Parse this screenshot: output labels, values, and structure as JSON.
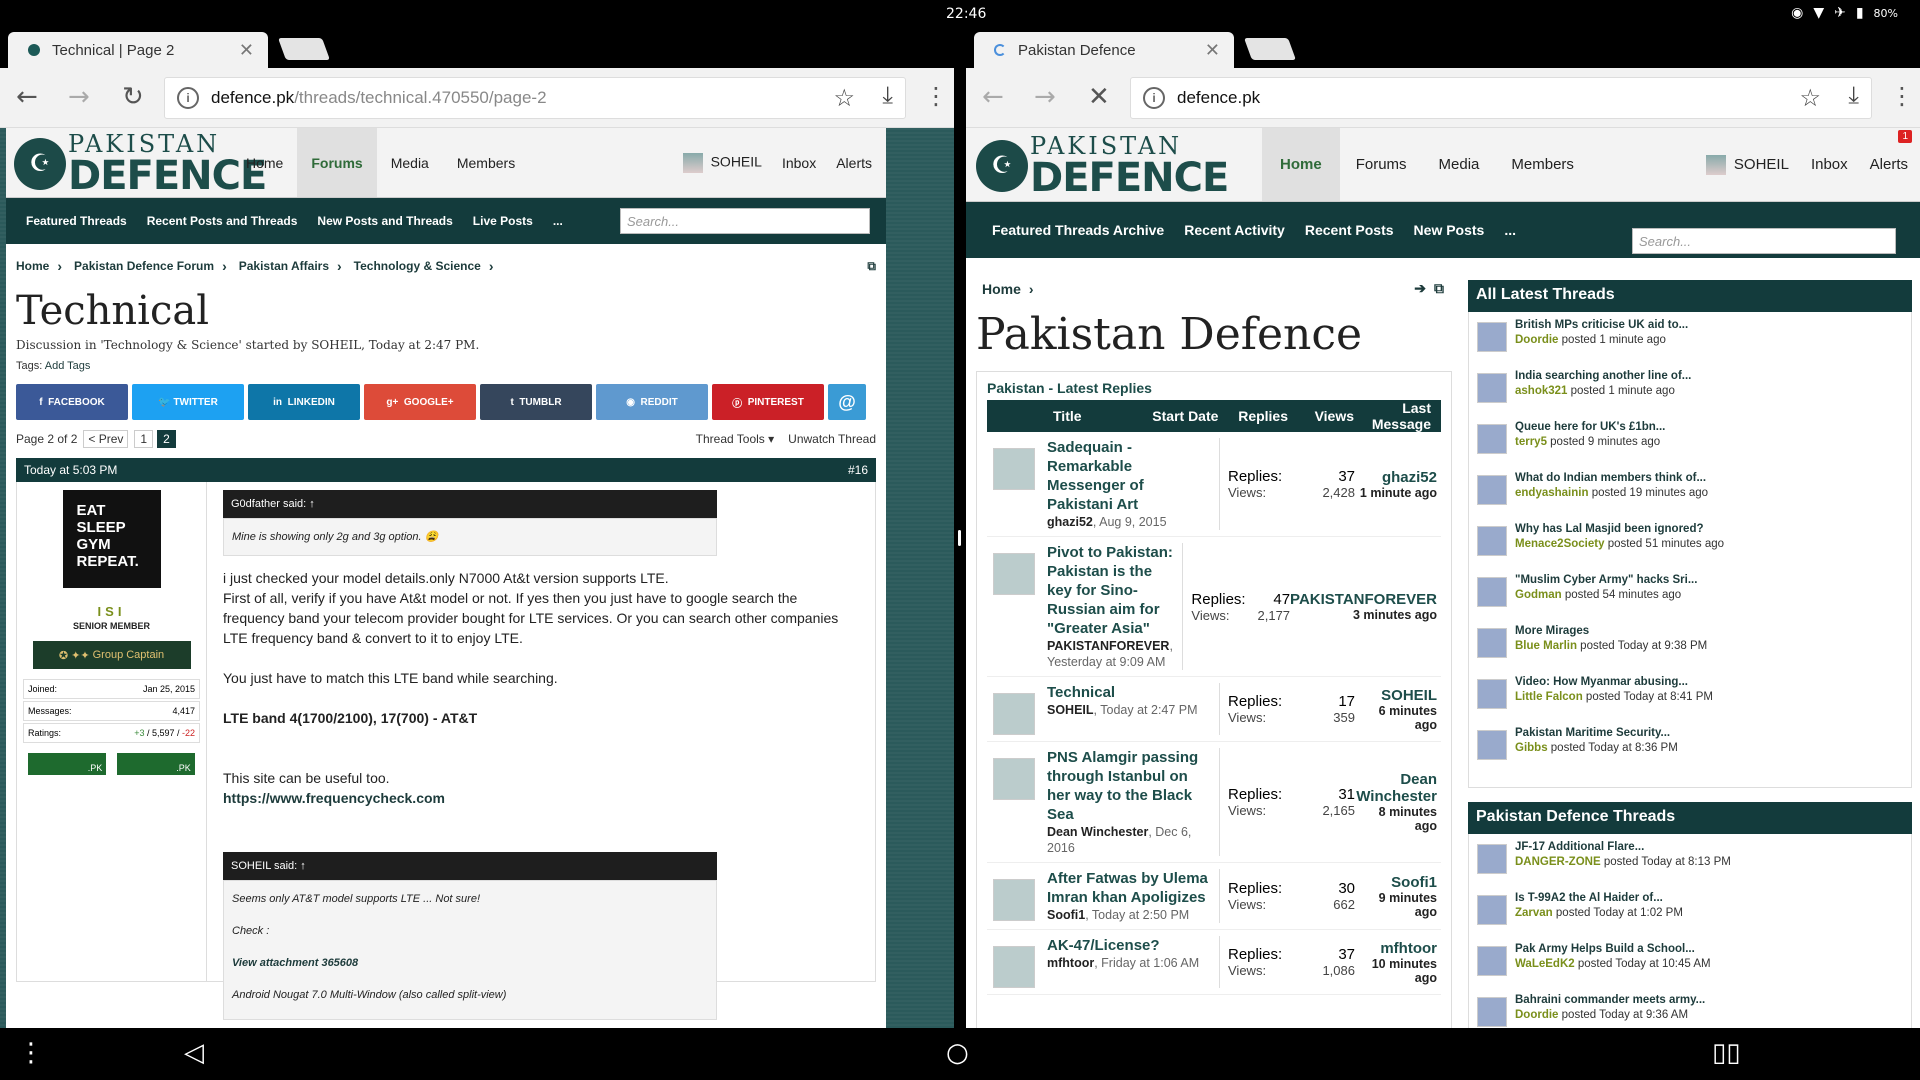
{
  "status": {
    "time": "22:46",
    "battery": "80%"
  },
  "left": {
    "tab_title": "Technical | Page 2",
    "url_host": "defence.pk",
    "url_path": "/threads/technical.470550/page-2",
    "logo_top": "PAKISTAN",
    "logo_bottom": "DEFENCE",
    "nav": [
      "Home",
      "Forums",
      "Media",
      "Members"
    ],
    "user": "SOHEIL",
    "inbox": "Inbox",
    "alerts": "Alerts",
    "subnav": [
      "Featured Threads",
      "Recent Posts and Threads",
      "New Posts and Threads",
      "Live Posts",
      "..."
    ],
    "search_placeholder": "Search...",
    "breadcrumb": [
      "Home",
      "Pakistan Defence Forum",
      "Pakistan Affairs",
      "Technology & Science"
    ],
    "title": "Technical",
    "discussion": "Discussion in 'Technology & Science' started by SOHEIL, Today at 2:47 PM.",
    "tags_label": "Tags:",
    "tags_add": "Add Tags",
    "social": [
      "FACEBOOK",
      "TWITTER",
      "LINKEDIN",
      "GOOGLE+",
      "TUMBLR",
      "REDDIT",
      "PINTEREST",
      "@"
    ],
    "page_of": "Page 2 of 2",
    "prev": "< Prev",
    "page1": "1",
    "page2": "2",
    "thread_tools": "Thread Tools ▾",
    "unwatch": "Unwatch Thread",
    "post_time": "Today at 5:03 PM",
    "post_num": "#16",
    "avatar_text": "EAT SLEEP GYM REPEAT.",
    "username": "ISI",
    "user_title": "SENIOR MEMBER",
    "rank": "Group Captain",
    "joined_l": "Joined:",
    "joined_v": "Jan 25, 2015",
    "messages_l": "Messages:",
    "messages_v": "4,417",
    "ratings_l": "Ratings:",
    "ratings_pos": "+3",
    "ratings_mid": " / 5,597 / ",
    "ratings_neg": "-22",
    "flag": ".PK",
    "quote1_head": "G0dfather said: ↑",
    "quote1_body": "Mine is showing only 2g and 3g option.",
    "p1": "i just checked your model details.only N7000 At&t version supports LTE.",
    "p2": "First of all, verify if you have At&t model or not. If yes then you just have to google search the frequency band your telecom provider bought for LTE services. Or you can search other companies LTE frequency band & convert to it to enjoy LTE.",
    "p3": "You just have to match this LTE band while searching.",
    "p4": "LTE band 4(1700/2100), 17(700) - AT&T",
    "p5": "This site can be useful too.",
    "p6": "https://www.frequencycheck.com",
    "quote2_head": "SOHEIL said: ↑",
    "quote2_l1": "Seems only AT&T model supports LTE ... Not sure!",
    "quote2_l2": "Check :",
    "quote2_l3": "View attachment 365608",
    "quote2_l4": "Android Nougat 7.0 Multi-Window (also called split-view)"
  },
  "right": {
    "tab_title": "Pakistan Defence",
    "url_host": "defence.pk",
    "nav": [
      "Home",
      "Forums",
      "Media",
      "Members"
    ],
    "user": "SOHEIL",
    "inbox": "Inbox",
    "alerts": "Alerts",
    "alert_count": "1",
    "subnav": [
      "Featured Threads Archive",
      "Recent Activity",
      "Recent Posts",
      "New Posts",
      "..."
    ],
    "search_placeholder": "Search...",
    "breadcrumb": "Home",
    "title": "Pakistan Defence",
    "latest_label": "Pakistan - Latest Replies",
    "cols": [
      "Title",
      "Start Date",
      "Replies",
      "Views",
      "Last Message"
    ],
    "threads": [
      {
        "title": "Sadequain - Remarkable Messenger of Pakistani Art",
        "by": "ghazi52",
        "date": ", Aug 9, 2015",
        "replies": "37",
        "views": "2,428",
        "last": "ghazi52",
        "ago": "1 minute ago"
      },
      {
        "title": "Pivot to Pakistan: Pakistan is the key for Sino-Russian aim for \"Greater Asia\"",
        "by": "PAKISTANFOREVER",
        "date": ", Yesterday at 9:09 AM",
        "replies": "47",
        "views": "2,177",
        "last": "PAKISTANFOREVER",
        "ago": "3 minutes ago"
      },
      {
        "title": "Technical",
        "by": "SOHEIL",
        "date": ", Today at 2:47 PM",
        "replies": "17",
        "views": "359",
        "last": "SOHEIL",
        "ago": "6 minutes ago"
      },
      {
        "title": "PNS Alamgir passing through Istanbul on her way to the Black Sea",
        "by": "Dean Winchester",
        "date": ", Dec 6, 2016",
        "replies": "31",
        "views": "2,165",
        "last": "Dean Winchester",
        "ago": "8 minutes ago"
      },
      {
        "title": "After Fatwas by Ulema Imran khan Apoligizes",
        "by": "Soofi1",
        "date": ", Today at 2:50 PM",
        "replies": "30",
        "views": "662",
        "last": "Soofi1",
        "ago": "9 minutes ago"
      },
      {
        "title": "AK-47/License?",
        "by": "mfhtoor",
        "date": ", Friday at 1:06 AM",
        "replies": "37",
        "views": "1,086",
        "last": "mfhtoor",
        "ago": "10 minutes ago"
      }
    ],
    "replies_l": "Replies:",
    "views_l": "Views:",
    "side1_title": "All Latest Threads",
    "side1": [
      {
        "t": "British MPs criticise UK aid to...",
        "u": "Doordie",
        "p": " posted 1 minute ago"
      },
      {
        "t": "India searching another line of...",
        "u": "ashok321",
        "p": " posted 1 minute ago"
      },
      {
        "t": "Queue here for UK's £1bn...",
        "u": "terry5",
        "p": " posted 9 minutes ago"
      },
      {
        "t": "What do Indian members think of...",
        "u": "endyashainin",
        "p": " posted 19 minutes ago"
      },
      {
        "t": "Why has Lal Masjid been ignored?",
        "u": "Menace2Society",
        "p": " posted 51 minutes ago"
      },
      {
        "t": "\"Muslim Cyber Army\" hacks Sri...",
        "u": "Godman",
        "p": " posted 54 minutes ago"
      },
      {
        "t": "More Mirages",
        "u": "Blue Marlin",
        "p": " posted Today at 9:38 PM"
      },
      {
        "t": "Video: How Myanmar abusing...",
        "u": "Little Falcon",
        "p": " posted Today at 8:41 PM"
      },
      {
        "t": "Pakistan Maritime Security...",
        "u": "Gibbs",
        "p": " posted Today at 8:36 PM"
      }
    ],
    "side2_title": "Pakistan Defence Threads",
    "side2": [
      {
        "t": "JF-17 Additional Flare...",
        "u": "DANGER-ZONE",
        "p": " posted Today at 8:13 PM"
      },
      {
        "t": "Is T-99A2 the Al Haider of...",
        "u": "Zarvan",
        "p": " posted Today at 1:02 PM"
      },
      {
        "t": "Pak Army Helps Build a School...",
        "u": "WaLeEdK2",
        "p": " posted Today at 10:45 AM"
      },
      {
        "t": "Bahraini commander meets army...",
        "u": "Doordie",
        "p": " posted Today at 9:36 AM"
      }
    ]
  },
  "colors": {
    "teal": "#133b3c",
    "green": "#2f6b39",
    "facebook": "#3b5998",
    "twitter": "#1da1f2",
    "linkedin": "#0e76a8",
    "google": "#dd4b39",
    "tumblr": "#35465c",
    "reddit": "#5f99cf",
    "pinterest": "#cb2027",
    "email": "#3a9bd5"
  }
}
